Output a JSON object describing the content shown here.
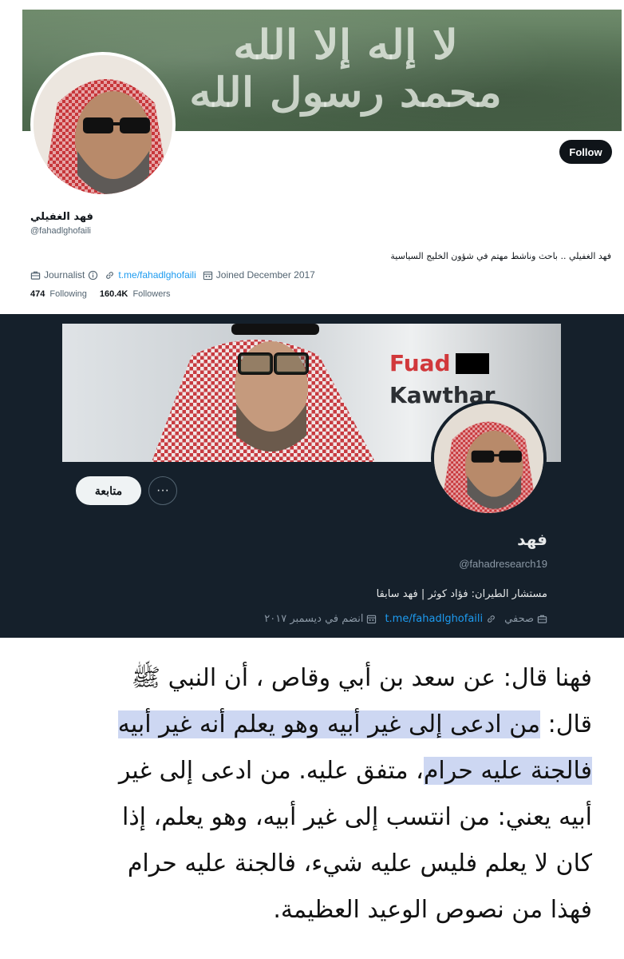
{
  "profile_light": {
    "banner_text": "لا إله إلا الله محمد رسول الله",
    "follow_label": "Follow",
    "name": "فهد الغفيلي",
    "handle": "@fahadlghofaili",
    "bio": "فهد الغفيلي .. باحث وناشط مهتم في شؤون الخليج السياسية",
    "meta": {
      "category": "Journalist",
      "category_icon": "briefcase-icon",
      "link": "t.me/fahadlghofaili",
      "joined": "Joined December 2017"
    },
    "stats": {
      "following_count": "474",
      "following_label": "Following",
      "followers_count": "160.4K",
      "followers_label": "Followers"
    }
  },
  "profile_dark": {
    "banner_name_line1": "Fuad",
    "banner_name_line2": "Kawthar",
    "follow_label": "متابعة",
    "more_label": "···",
    "name": "فهد",
    "handle": "@fahadresearch19",
    "bio": "مستشار الطيران: فؤاد كوثر | فهد سابقا",
    "meta": {
      "category": "صحفي",
      "link": "t.me/fahadlghofaili",
      "joined": "انضم في ديسمبر ٢٠١٧"
    }
  },
  "article": {
    "lines": [
      "فهنا قال: عن سعد بن أبي وقاص ، أن النبي ﷺ",
      "من ادعى إلى غير أبيه وهو يعلم أنه غير أبيه",
      "فالجنة عليه حرام",
      "، متفق عليه. من ادعى إلى غير",
      "أبيه يعني: من انتسب إلى غير أبيه، وهو يعلم، إذا",
      "كان لا يعلم فليس عليه شيء، فالجنة عليه حرام",
      "فهذا من نصوص الوعيد العظيمة."
    ],
    "line2_prefix": "قال: "
  },
  "colors": {
    "light_bg": "#ffffff",
    "dark_bg": "#15202b",
    "link_blue": "#1d9bf0",
    "highlight": "#cdd7f2",
    "fuad_red": "#d1383b"
  }
}
